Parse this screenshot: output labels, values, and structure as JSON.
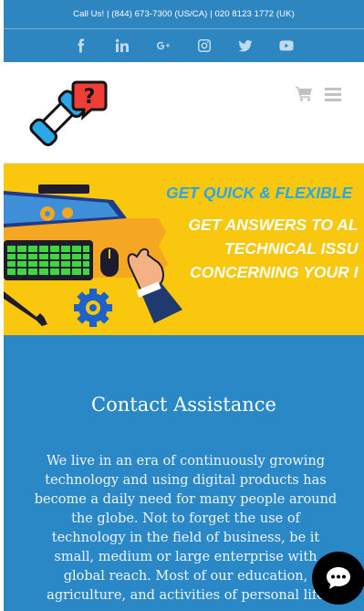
{
  "topbar": {
    "call_text": "Call Us! | (844) 673-7300 (US/CA) | 020 8123 1772 (UK)",
    "social_icons": [
      "facebook-icon",
      "linkedin-icon",
      "google-plus-icon",
      "instagram-icon",
      "twitter-icon",
      "youtube-icon"
    ],
    "background": "#2e86c1"
  },
  "header": {
    "icons": [
      "cart-icon",
      "menu-icon"
    ]
  },
  "banner": {
    "line1": "GET QUICK & FLEXIBLE",
    "line2": "GET ANSWERS TO AL",
    "line3": "TECHNICAL ISSU",
    "line4": "CONCERNING YOUR I",
    "background": "#f9c80e",
    "accent": "#29a7e6"
  },
  "contact": {
    "title": "Contact Assistance",
    "body": "We live in an era of continuously growing technology and using digital products has become a daily need for many people around the globe. Not to forget the use of technology in the field of business, be it small, medium or large enterprise with global reach. Most of our education, agriculture, and activities of personal life",
    "background": "#2b88c6"
  },
  "chat": {
    "icon": "chat-bubble-icon"
  }
}
